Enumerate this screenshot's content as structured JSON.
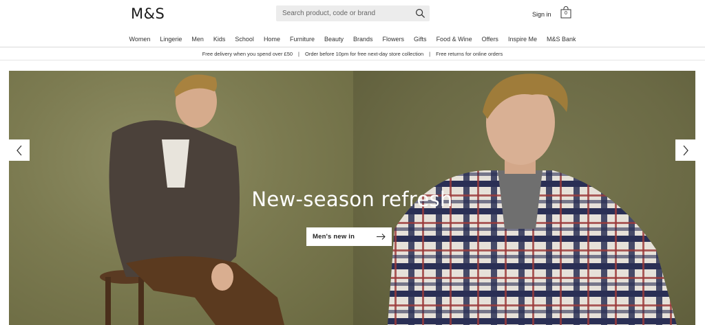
{
  "header": {
    "logo": "M&S",
    "search_placeholder": "Search product, code or brand",
    "sign_in": "Sign in",
    "bag_count": "0"
  },
  "nav": {
    "items": [
      "Women",
      "Lingerie",
      "Men",
      "Kids",
      "School",
      "Home",
      "Furniture",
      "Beauty",
      "Brands",
      "Flowers",
      "Gifts",
      "Food & Wine",
      "Offers",
      "Inspire Me",
      "M&S Bank"
    ]
  },
  "promo": {
    "items": [
      "Free delivery when you spend over £50",
      "Order before 10pm for free next-day store collection",
      "Free returns for online orders"
    ]
  },
  "hero": {
    "title": "New-season refresh",
    "cta_label": "Men's new in"
  },
  "colors": {
    "hero_olive": "#7a7950",
    "search_bg": "#ececec"
  }
}
